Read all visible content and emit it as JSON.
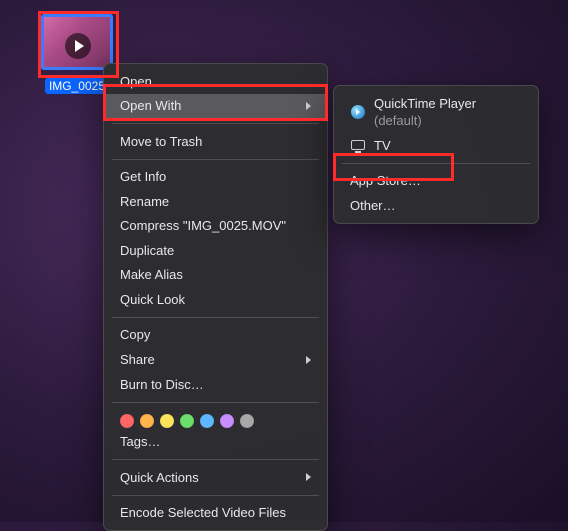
{
  "file": {
    "name": "IMG_0025"
  },
  "menu": {
    "open": "Open",
    "openWith": "Open With",
    "moveToTrash": "Move to Trash",
    "getInfo": "Get Info",
    "rename": "Rename",
    "compress": "Compress \"IMG_0025.MOV\"",
    "duplicate": "Duplicate",
    "makeAlias": "Make Alias",
    "quickLook": "Quick Look",
    "copy": "Copy",
    "share": "Share",
    "burn": "Burn to Disc…",
    "tags": "Tags…",
    "quickActions": "Quick Actions",
    "encode": "Encode Selected Video Files"
  },
  "submenu": {
    "quicktime": "QuickTime Player",
    "defaultSuffix": " (default)",
    "tv": "TV",
    "appStore": "App Store…",
    "other": "Other…"
  },
  "tagColors": [
    "#ff6766",
    "#ffb54c",
    "#ffe25b",
    "#6ade6a",
    "#5fb8ff",
    "#c78cff",
    "#a8a8a8"
  ]
}
